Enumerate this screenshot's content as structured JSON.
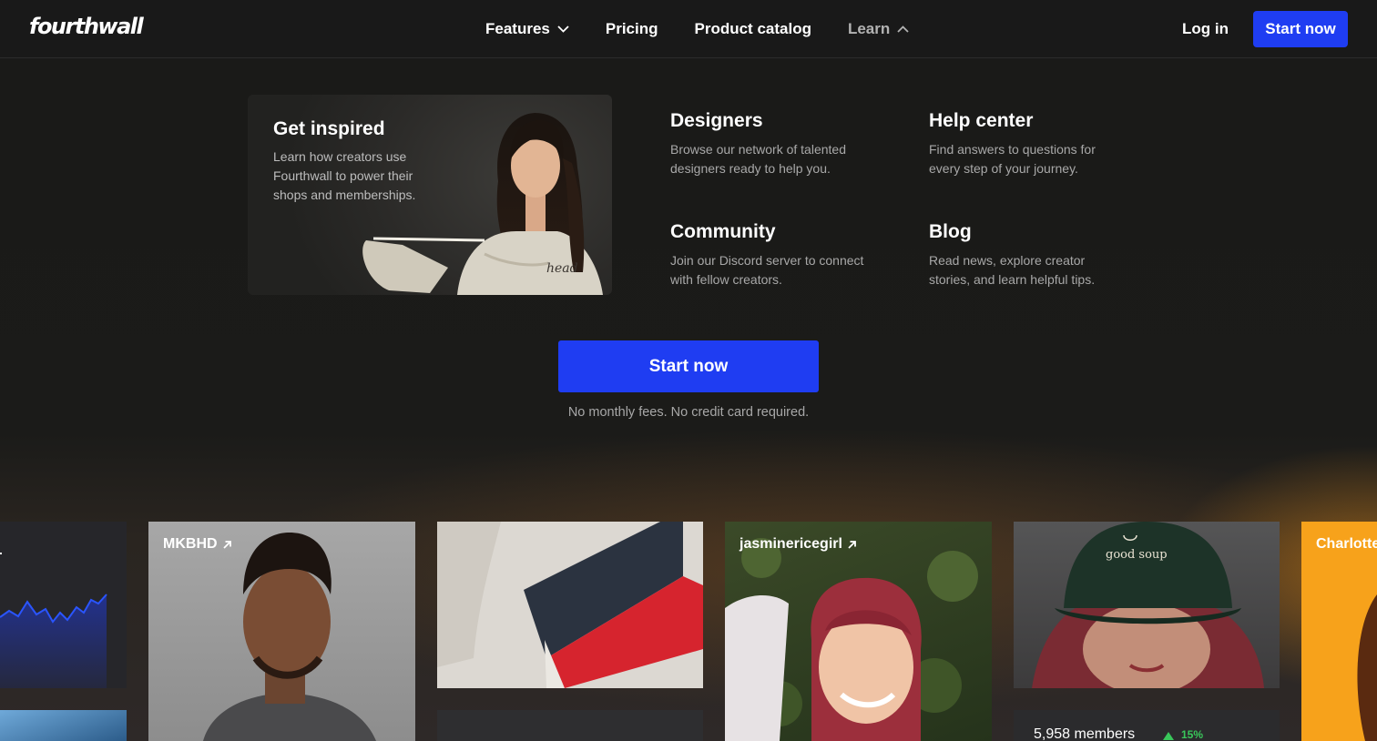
{
  "nav": {
    "logo": "fourthwall",
    "links": [
      {
        "label": "Features",
        "chevron": "down"
      },
      {
        "label": "Pricing"
      },
      {
        "label": "Product catalog"
      },
      {
        "label": "Learn",
        "chevron": "up"
      }
    ],
    "login": "Log in",
    "cta": "Start now"
  },
  "learn_menu": {
    "featured": {
      "title": "Get inspired",
      "description": "Learn how creators use Fourthwall to power their shops and memberships."
    },
    "items": [
      {
        "title": "Designers",
        "description": "Browse our network of talented designers ready to help you."
      },
      {
        "title": "Help center",
        "description": "Find answers to questions for every step of your journey."
      },
      {
        "title": "Community",
        "description": "Join our Discord server to connect with fellow creators."
      },
      {
        "title": "Blog",
        "description": "Read news, explore creator stories, and learn helpful tips."
      }
    ],
    "cta": "Start now",
    "cta_note": "No monthly fees. No credit card required."
  },
  "showcase": {
    "creators": [
      "MKBHD",
      "jasminericegirl",
      "Charlotte"
    ],
    "stats": {
      "members": "5,958 members",
      "growth": "15%"
    }
  },
  "colors": {
    "accent": "#1f3df2",
    "background": "#1a1a1a",
    "positive": "#39c75a",
    "orange_card": "#f7a21b"
  }
}
